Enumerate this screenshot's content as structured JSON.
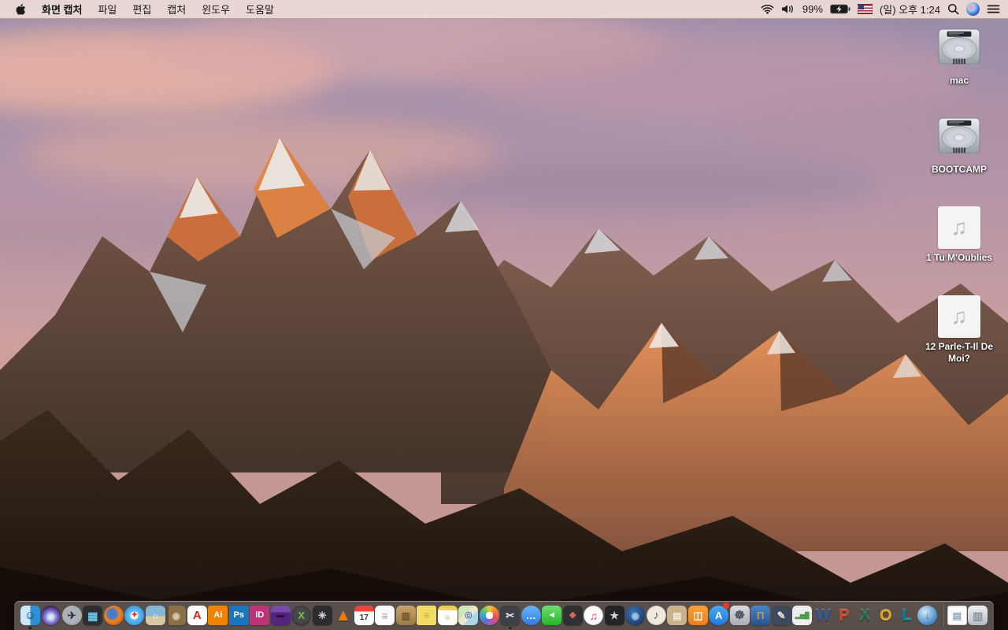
{
  "menubar": {
    "app_name": "화면 캡처",
    "menus": [
      "파일",
      "편집",
      "캡처",
      "윈도우",
      "도움말"
    ],
    "status": {
      "battery_percent": "99%",
      "clock": "(일) 오후 1:24"
    }
  },
  "desktop": {
    "audio_glyph": "♫",
    "icons": [
      {
        "name": "drive-mac",
        "type": "drive",
        "label": "mac"
      },
      {
        "name": "drive-bootcamp",
        "type": "drive",
        "label": "BOOTCAMP"
      },
      {
        "name": "audio-tu-moublies",
        "type": "audio",
        "label": "1 Tu M'Oublies"
      },
      {
        "name": "audio-parle-t-il-de-moi",
        "type": "audio",
        "label": "12 Parle-T-Il De Moi?"
      }
    ]
  },
  "dock": {
    "items": [
      {
        "name": "finder",
        "shape": "rounded",
        "bg": "linear-gradient(90deg,#cde9f9 50%,#2f8fd6 50%)",
        "fg": "#0d3a66",
        "glyph": "☺",
        "fs": 15,
        "running": true
      },
      {
        "name": "siri",
        "shape": "circle",
        "bg": "radial-gradient(circle at 50% 58%,#cdeef8 0 14%,#8a6fd4 40%,#27224e 75%)",
        "glyph": ""
      },
      {
        "name": "launchpad",
        "shape": "circle",
        "bg": "radial-gradient(circle at 50% 40%,#aab2b8 0 60%,#7e858b 100%)",
        "glyph": "✈",
        "fg": "#2e3338",
        "fs": 13
      },
      {
        "name": "mission-control",
        "shape": "rounded",
        "bg": "#2b2e33",
        "glyph": "▦",
        "fg": "#6fc4e0",
        "fs": 14
      },
      {
        "name": "firefox",
        "shape": "circle",
        "bg": "radial-gradient(circle at 42% 42%,#4a7bc8 0 28%,#f0821e 45%,#b54a10 100%)",
        "glyph": ""
      },
      {
        "name": "safari",
        "shape": "circle",
        "bg": "radial-gradient(circle at 50% 50%,#f8fbfd 0 26%,#62c2f5 30%,#1d7fd4 100%)",
        "glyph": "✦",
        "fg": "#e3392b",
        "fs": 11
      },
      {
        "name": "preview",
        "shape": "rounded",
        "bg": "linear-gradient(180deg,#86b7d8 55%,#d9c8a6 55%)",
        "glyph": "○",
        "fg": "#ffffff",
        "fs": 12
      },
      {
        "name": "contacts",
        "shape": "rounded",
        "bg": "linear-gradient(90deg,#5e4730 12%,#8b6f47 12%)",
        "glyph": "◉",
        "fg": "#d9c9a6",
        "fs": 12
      },
      {
        "name": "acrobat-reader",
        "shape": "rounded",
        "bg": "#ffffff",
        "glyph": "A",
        "fg": "#d4281c",
        "fs": 15
      },
      {
        "name": "illustrator",
        "shape": "square",
        "bg": "#f08300",
        "glyph": "Ai",
        "fg": "#ffffff",
        "fs": 11
      },
      {
        "name": "photoshop",
        "shape": "square",
        "bg": "#1c75bc",
        "glyph": "Ps",
        "fg": "#ffffff",
        "fs": 11
      },
      {
        "name": "indesign",
        "shape": "square",
        "bg": "#bd3278",
        "glyph": "ID",
        "fg": "#ffffff",
        "fs": 11
      },
      {
        "name": "toast-titanium",
        "shape": "rounded",
        "bg": "linear-gradient(180deg,#7a4aa8 0 35%,#55257e 35%)",
        "glyph": "▬",
        "fg": "#2a1040",
        "fs": 10
      },
      {
        "name": "xld",
        "shape": "circle",
        "bg": "radial-gradient(circle,#454749 0 55%,#161718 100%)",
        "glyph": "X",
        "fg": "#74c83c",
        "fs": 13
      },
      {
        "name": "fan-control",
        "shape": "rounded",
        "bg": "#2a2c2f",
        "glyph": "✳",
        "fg": "#d8dadc",
        "fs": 13
      },
      {
        "name": "vlc",
        "shape": "plain",
        "glyph": "▲",
        "fg": "#f57900"
      },
      {
        "name": "calendar",
        "shape": "rounded",
        "bg": "linear-gradient(180deg,#e8463a 0 30%,#fcfcfc 30%)",
        "glyph": "17",
        "fg": "#333333",
        "fs": 10,
        "pt": 7
      },
      {
        "name": "reminders",
        "shape": "rounded",
        "bg": "#fbfbfb",
        "glyph": "≡",
        "fg": "#9aa0a8",
        "fs": 14
      },
      {
        "name": "unarchiver",
        "shape": "rounded",
        "bg": "linear-gradient(180deg,#c8a468,#9a7b45)",
        "glyph": "▥",
        "fg": "#6a5228",
        "fs": 12
      },
      {
        "name": "stickies",
        "shape": "square",
        "bg": "#f2dd62",
        "glyph": "≡",
        "fg": "#c9aa3a",
        "fs": 13
      },
      {
        "name": "notes",
        "shape": "rounded",
        "bg": "linear-gradient(180deg,#f2cf5b 0 24%,#fdfdf6 24%)",
        "glyph": "≡",
        "fg": "#c8c8c0",
        "fs": 12,
        "pt": 5
      },
      {
        "name": "maps",
        "shape": "rounded",
        "bg": "linear-gradient(135deg,#cfe8b9 0 38%,#ede5cd 38% 62%,#aed4e8 62%)",
        "glyph": "◎",
        "fg": "#3a78c8",
        "fs": 11
      },
      {
        "name": "photos",
        "shape": "circle",
        "bg": "radial-gradient(circle,#ffffff 0 26%,rgba(255,255,255,0) 27%),conic-gradient(#f5c63a,#ef8c3a,#e85a4a,#d44a8c,#9a5ac8,#4a78d4,#3aa8d8,#5ac86a,#f5c63a)",
        "glyph": ""
      },
      {
        "name": "grab-screen-capture",
        "shape": "rounded",
        "bg": "#3d4147",
        "glyph": "✂",
        "fg": "#e8eaec",
        "fs": 13,
        "running": true
      },
      {
        "name": "messages",
        "shape": "circle",
        "bg": "linear-gradient(180deg,#6ab4f8,#2e7ce0)",
        "glyph": "…",
        "fg": "#ffffff",
        "fs": 13
      },
      {
        "name": "facetime",
        "shape": "rounded",
        "bg": "linear-gradient(180deg,#6ee06e,#28b428)",
        "glyph": "◄",
        "fg": "#ffffff",
        "fs": 11
      },
      {
        "name": "photo-booth",
        "shape": "rounded",
        "bg": "#2e3134",
        "glyph": "◆",
        "fg": "#d4695c",
        "fs": 11
      },
      {
        "name": "itunes",
        "shape": "circle",
        "bg": "#fdfdfd",
        "glyph": "♫",
        "fg": "#e0457b",
        "fs": 14,
        "bd": "1px solid rgba(0,0,0,0.15)"
      },
      {
        "name": "imovie",
        "shape": "rounded",
        "bg": "#222427",
        "glyph": "★",
        "fg": "#d0d2d4",
        "fs": 13
      },
      {
        "name": "idvd",
        "shape": "circle",
        "bg": "radial-gradient(circle at 40% 35%,#3a74b8,#142c54)",
        "glyph": "◉",
        "fg": "#9cc4e8",
        "fs": 12
      },
      {
        "name": "garageband",
        "shape": "circle",
        "bg": "#efe9df",
        "glyph": "♪",
        "fg": "#8b4a2f",
        "fs": 15,
        "bd": "1px solid rgba(0,0,0,0.15)"
      },
      {
        "name": "clippings-app",
        "shape": "rounded",
        "bg": "#c9b28a",
        "glyph": "▤",
        "fg": "#f2ede2",
        "fs": 12
      },
      {
        "name": "ibooks",
        "shape": "rounded",
        "bg": "linear-gradient(180deg,#f6a13c,#ee7d18)",
        "glyph": "◫",
        "fg": "#ffffff",
        "fs": 13
      },
      {
        "name": "app-store",
        "shape": "circle",
        "bg": "linear-gradient(180deg,#4aa8f0,#1f7ce0)",
        "glyph": "A",
        "fg": "#ffffff",
        "fs": 13,
        "badge": true
      },
      {
        "name": "system-preferences",
        "shape": "rounded",
        "bg": "linear-gradient(180deg,#d8dade,#a8aeb6)",
        "glyph": "☸",
        "fg": "#4a4e54",
        "fs": 15
      },
      {
        "name": "keynote",
        "shape": "rounded",
        "bg": "linear-gradient(180deg,#4a86c8,#27548c)",
        "glyph": "Π",
        "fg": "#c9995c",
        "fs": 13
      },
      {
        "name": "pages",
        "shape": "rounded",
        "bg": "#3c4a5c",
        "glyph": "✎",
        "fg": "#e8e4da",
        "fs": 13
      },
      {
        "name": "numbers",
        "shape": "rounded",
        "bg": "#eceef0",
        "glyph": "▂▅█",
        "fg": "#4a9e4a",
        "fs": 8
      },
      {
        "name": "ms-word",
        "shape": "plain",
        "glyph": "W",
        "fg": "#2b579a"
      },
      {
        "name": "ms-powerpoint",
        "shape": "plain",
        "glyph": "P",
        "fg": "#d24726"
      },
      {
        "name": "ms-excel",
        "shape": "plain",
        "glyph": "X",
        "fg": "#1e7145"
      },
      {
        "name": "ms-outlook",
        "shape": "plain",
        "glyph": "O",
        "fg": "#e8a81a"
      },
      {
        "name": "ms-lync",
        "shape": "plain",
        "glyph": "L",
        "fg": "#008299"
      },
      {
        "name": "download-manager",
        "shape": "circle",
        "bg": "radial-gradient(circle at 38% 32%,#cfe8f8,#4a88c8 70%,#2a5a94)",
        "glyph": "↓",
        "fg": "#2a9e3a",
        "fs": 13
      }
    ],
    "trailing": [
      {
        "name": "document-file",
        "shape": "square",
        "bg": "#fcfcfc",
        "glyph": "▤",
        "fg": "#8aa4c0",
        "fs": 12,
        "bd": "1px solid rgba(0,0,0,0.2)"
      },
      {
        "name": "trash",
        "shape": "rounded",
        "bg": "linear-gradient(180deg,#eef1f4,#b5bcc4)",
        "glyph": "▥",
        "fg": "#8a929c",
        "fs": 14
      }
    ]
  }
}
